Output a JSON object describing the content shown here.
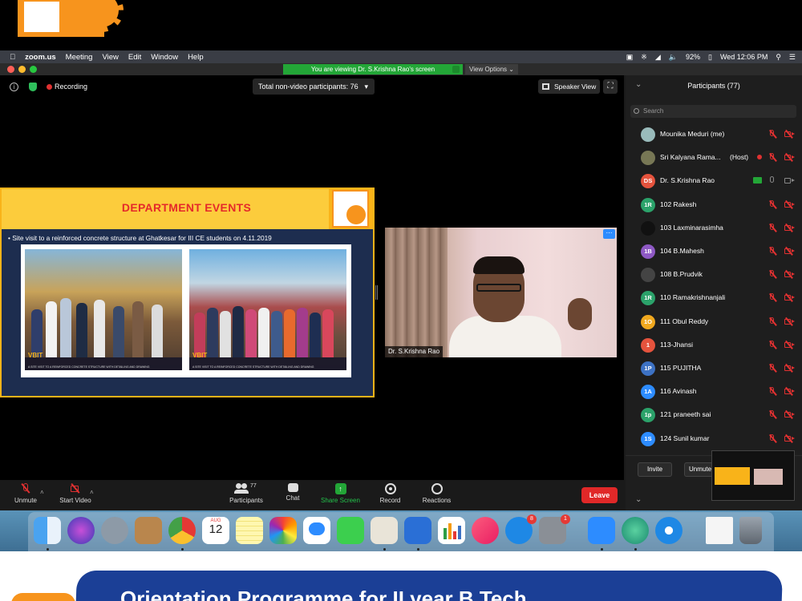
{
  "menubar": {
    "app": "zoom.us",
    "items": [
      "Meeting",
      "View",
      "Edit",
      "Window",
      "Help"
    ],
    "battery": "92%",
    "datetime": "Wed 12:06 PM"
  },
  "zoom": {
    "viewing_banner": "You are viewing Dr. S.Krishna Rao's screen",
    "view_options": "View Options",
    "recording_label": "Recording",
    "nonvideo_label": "Total non-video participants: 76",
    "speaker_view_label": "Speaker View",
    "speaker_name": "Dr. S.Krishna Rao"
  },
  "slide": {
    "title": "DEPARTMENT EVENTS",
    "bullet": "• Site visit to a reinforced concrete structure at Ghatkesar for III CE students on 4.11.2019",
    "photo_brand": "VBIT",
    "photo_caption": "A SITE VISIT TO A REINFORCED CONCRETE STRUCTURE WITH DETAILING AND DRAWING"
  },
  "participants": {
    "header": "Participants (77)",
    "search_placeholder": "Search",
    "list": [
      {
        "initials": "",
        "name": "Mounika Meduri (me)",
        "color": "#9bb",
        "photo": true
      },
      {
        "initials": "",
        "name": "Sri Kalyana Rama...",
        "tag": "(Host)",
        "color": "#775",
        "photo": true
      },
      {
        "initials": "DS",
        "name": "Dr. S.Krishna Rao",
        "color": "#e5533d",
        "sharing": true
      },
      {
        "initials": "1R",
        "name": "102 Rakesh",
        "color": "#2ba26a"
      },
      {
        "initials": "",
        "name": "103 Laxminarasimha",
        "color": "#111"
      },
      {
        "initials": "1B",
        "name": "104 B.Mahesh",
        "color": "#8e59c4"
      },
      {
        "initials": "",
        "name": "108 B.Prudvik",
        "color": "#444",
        "photo": true
      },
      {
        "initials": "1R",
        "name": "110 Ramakrishnanjali",
        "color": "#2ba26a"
      },
      {
        "initials": "1O",
        "name": "111 Obul Reddy",
        "color": "#f0a81e"
      },
      {
        "initials": "1",
        "name": "113-Jhansi",
        "color": "#e5533d"
      },
      {
        "initials": "1P",
        "name": "115 PUJITHA",
        "color": "#3d72c4"
      },
      {
        "initials": "1A",
        "name": "116 Avinash",
        "color": "#2d8cff"
      },
      {
        "initials": "1p",
        "name": "121 praneeth sai",
        "color": "#2ba26a"
      },
      {
        "initials": "1S",
        "name": "124 Sunil kumar",
        "color": "#2d8cff"
      }
    ],
    "invite_label": "Invite",
    "unmute_label": "Unmute"
  },
  "toolbar": {
    "unmute": "Unmute",
    "start_video": "Start Video",
    "participants": "Participants",
    "participants_count": "77",
    "chat": "Chat",
    "share_screen": "Share Screen",
    "record": "Record",
    "reactions": "Reactions",
    "leave": "Leave"
  },
  "dock": {
    "calendar_month": "AUG",
    "calendar_day": "12",
    "appstore_badge": "8",
    "settings_badge": "1"
  },
  "banner": {
    "text": "Orientation Programme for II year B.Tech"
  }
}
